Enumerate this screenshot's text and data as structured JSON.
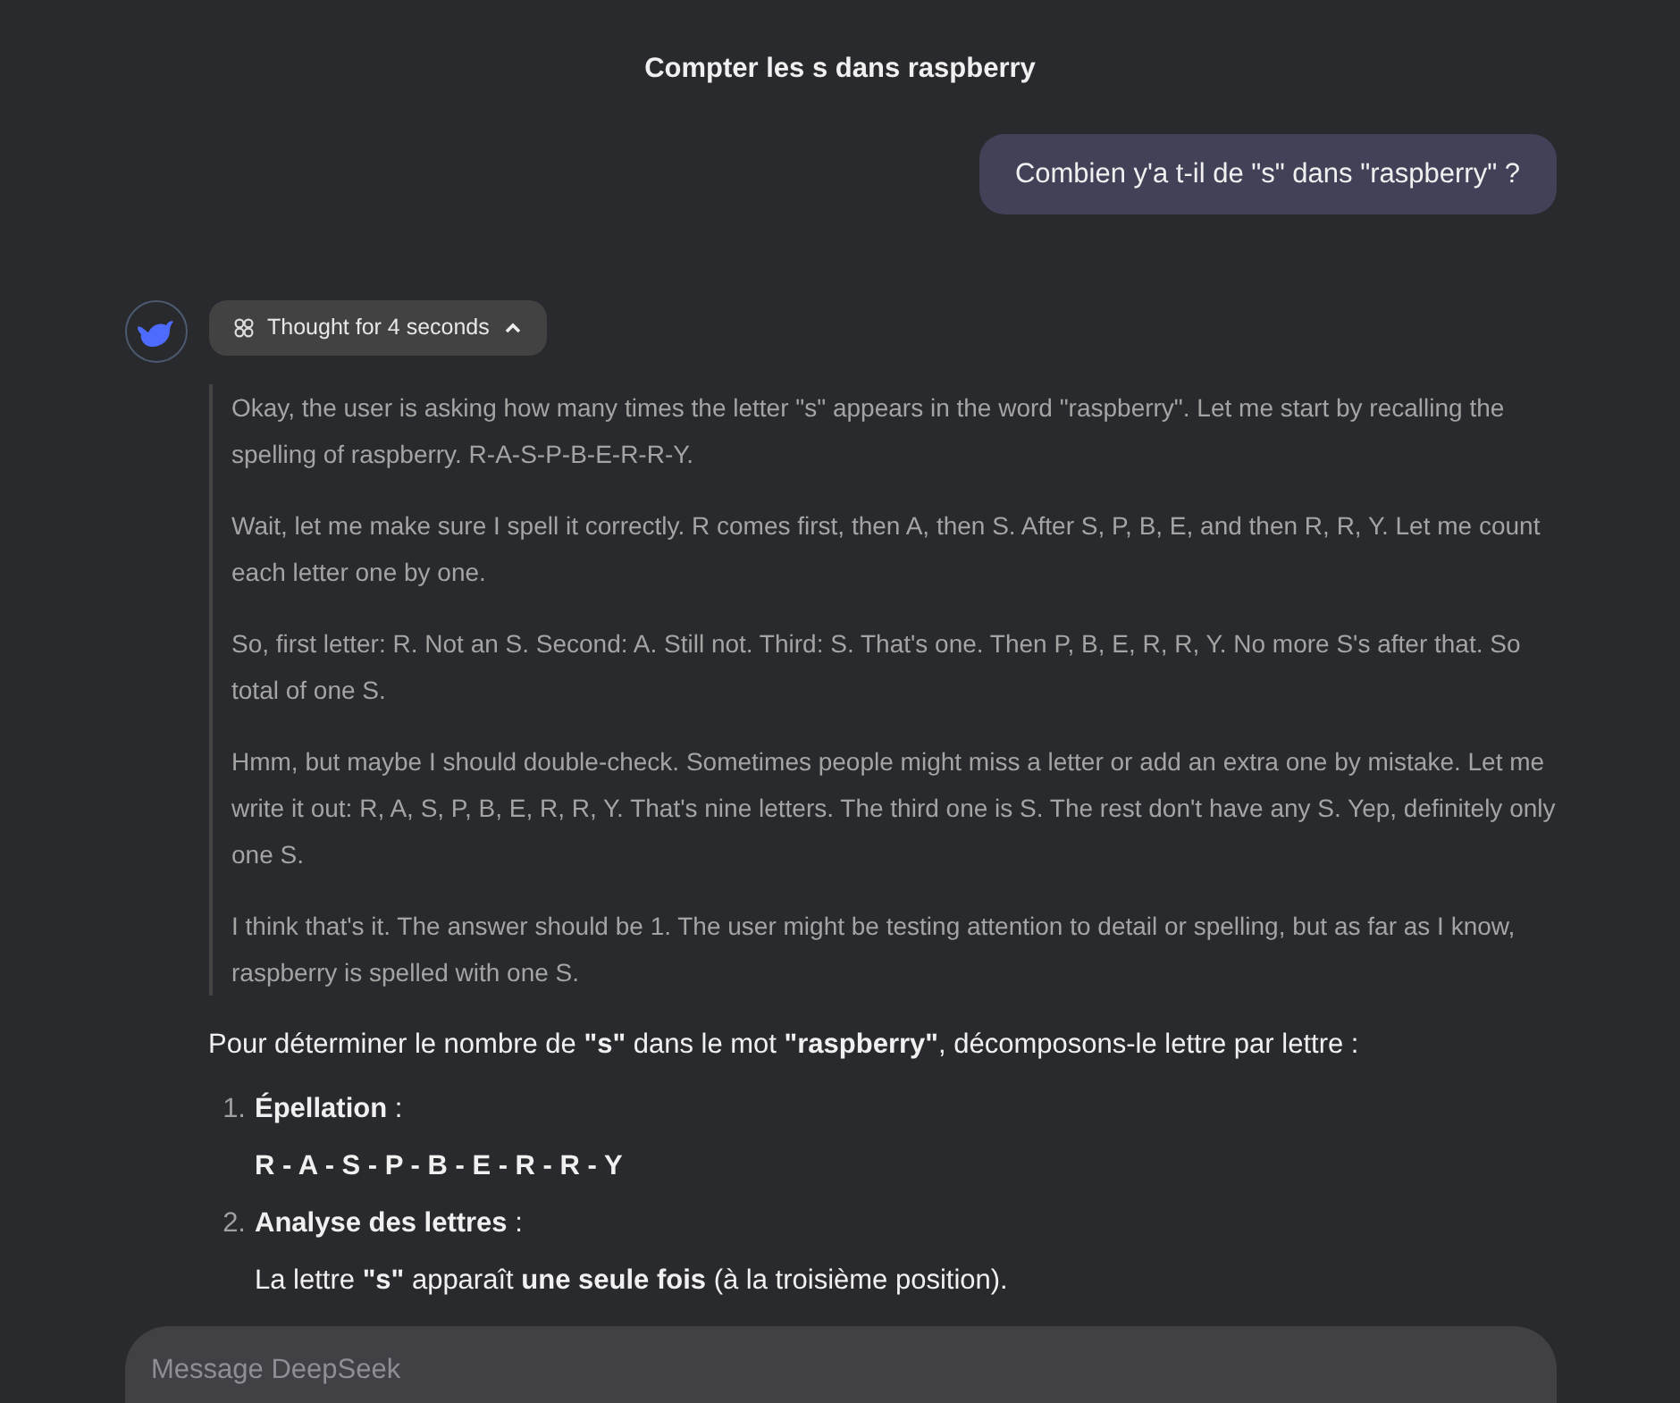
{
  "chat": {
    "title": "Compter les s dans raspberry"
  },
  "user_message": "Combien y'a t-il de \"s\" dans \"raspberry\" ?",
  "thinking": {
    "label": "Thought for 4 seconds",
    "expanded": true,
    "paragraphs": [
      "Okay, the user is asking how many times the letter \"s\" appears in the word \"raspberry\". Let me start by recalling the spelling of raspberry. R-A-S-P-B-E-R-R-Y.",
      "Wait, let me make sure I spell it correctly. R comes first, then A, then S. After S, P, B, E, and then R, R, Y. Let me count each letter one by one.",
      "So, first letter: R. Not an S. Second: A. Still not. Third: S. That's one. Then P, B, E, R, R, Y. No more S's after that. So total of one S.",
      "Hmm, but maybe I should double-check. Sometimes people might miss a letter or add an extra one by mistake. Let me write it out: R, A, S, P, B, E, R, R, Y. That's nine letters. The third one is S. The rest don't have any S. Yep, definitely only one S.",
      "I think that's it. The answer should be 1. The user might be testing attention to detail or spelling, but as far as I know, raspberry is spelled with one S."
    ]
  },
  "answer": {
    "intro": "Pour déterminer le nombre de **\"s\"** dans le mot **\"raspberry\"**, décomposons-le lettre par lettre :",
    "steps": [
      {
        "number": "1.",
        "title": "Épellation",
        "suffix": " :",
        "detail": "**R - A - S - P - B - E - R - R - Y**"
      },
      {
        "number": "2.",
        "title": "Analyse des lettres",
        "suffix": " :",
        "detail": "La lettre **\"s\"** apparaît **une seule fois** (à la troisième position)."
      }
    ]
  },
  "composer": {
    "placeholder": "Message DeepSeek"
  }
}
